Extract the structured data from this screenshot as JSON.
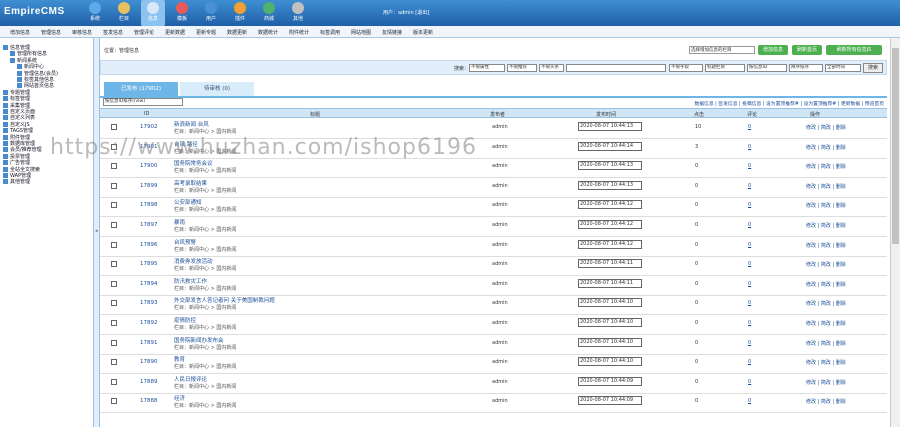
{
  "app": {
    "logo": "EmpireCMS"
  },
  "top_nav": [
    {
      "label": "系统",
      "icon": "globe-icon",
      "color": "#5fa8e8"
    },
    {
      "label": "栏目",
      "icon": "folder-icon",
      "color": "#e8c060"
    },
    {
      "label": "信息",
      "icon": "document-icon",
      "color": "#d8e8f8"
    },
    {
      "label": "模板",
      "icon": "template-icon",
      "color": "#e85a5a"
    },
    {
      "label": "用户",
      "icon": "user-icon",
      "color": "#4a90d9"
    },
    {
      "label": "插件",
      "icon": "plugin-icon",
      "color": "#f0a030"
    },
    {
      "label": "商城",
      "icon": "shop-icon",
      "color": "#50b070"
    },
    {
      "label": "其他",
      "icon": "gear-icon",
      "color": "#c0c0c0"
    }
  ],
  "user_info": "用户：admin [退出]",
  "menu_bar": [
    "增加信息",
    "管理信息",
    "审核信息",
    "签发信息",
    "管理评论",
    "更新数据",
    "更新专题",
    "数据更新",
    "数据统计",
    "附件统计",
    "标签调用",
    "网站地图",
    "友情链接",
    "版本更新"
  ],
  "sidebar": [
    {
      "label": "信息管理",
      "indent": 0
    },
    {
      "label": "管理所有信息",
      "indent": 1
    },
    {
      "label": "新闻系统",
      "indent": 1
    },
    {
      "label": "新闻中心",
      "indent": 2
    },
    {
      "label": "管理信息(会员)",
      "indent": 2
    },
    {
      "label": "标签其他信息",
      "indent": 2
    },
    {
      "label": "网站首页信息",
      "indent": 2
    },
    {
      "label": "专题管理",
      "indent": 0
    },
    {
      "label": "标签管理",
      "indent": 0
    },
    {
      "label": "采集管理",
      "indent": 0
    },
    {
      "label": "自定义页面",
      "indent": 0
    },
    {
      "label": "自定义列表",
      "indent": 0
    },
    {
      "label": "自定义JS",
      "indent": 0
    },
    {
      "label": "TAGS管理",
      "indent": 0
    },
    {
      "label": "附件管理",
      "indent": 0
    },
    {
      "label": "数据库管理",
      "indent": 0
    },
    {
      "label": "会员/推荐管理",
      "indent": 0
    },
    {
      "label": "投票管理",
      "indent": 0
    },
    {
      "label": "广告管理",
      "indent": 0
    },
    {
      "label": "全站全文搜索",
      "indent": 0
    },
    {
      "label": "WAP管理",
      "indent": 0
    },
    {
      "label": "其他管理",
      "indent": 0
    }
  ],
  "breadcrumb": "位置：管理信息",
  "channel_select": "选择增加信息的栏目",
  "buttons": {
    "add": "增加信息",
    "refresh": "刷新首页",
    "refresh_all": "刷新所有信息JS"
  },
  "search": {
    "label": "搜索：",
    "selects": [
      "不限属性",
      "不限推荐",
      "不限头条",
      "",
      "不限字段",
      "标题栏目",
      "按信息ID",
      "降序排序",
      "全部时间"
    ],
    "button": "搜索"
  },
  "tabs": {
    "published": "已发布 (17902)",
    "pending": "待审核 (0)"
  },
  "view_select": "按信息ID排序(new)",
  "links": "数据信息 | 签发信息 | 投稿信息 | 设为置顶推荐# | 设为置顶推荐# | 更新数据 | 预览首页",
  "table": {
    "headers": {
      "id": "ID",
      "title": "标题",
      "publisher": "发布者",
      "date": "发布时间",
      "clicks": "点击",
      "comments": "评论",
      "ops": "操作"
    },
    "rows": [
      {
        "id": "17902",
        "title": "新浪新闻 台风",
        "column": "栏目：新闻中心 > 国内新闻",
        "publisher": "admin",
        "date": "2020-08-07 10:44:13",
        "clicks": "10",
        "comments": "0"
      },
      {
        "id": "17901",
        "title": "台风 路径",
        "column": "栏目：新闻中心 > 国内新闻",
        "publisher": "admin",
        "date": "2020-08-07 10:44:14",
        "clicks": "3",
        "comments": "0"
      },
      {
        "id": "17900",
        "title": "国务院常务会议",
        "column": "栏目：新闻中心 > 国内新闻",
        "publisher": "admin",
        "date": "2020-08-07 10:44:13",
        "clicks": "0",
        "comments": "0"
      },
      {
        "id": "17899",
        "title": "高考录取结果",
        "column": "栏目：新闻中心 > 国内新闻",
        "publisher": "admin",
        "date": "2020-08-07 10:44:13",
        "clicks": "0",
        "comments": "0"
      },
      {
        "id": "17898",
        "title": "公安部通知",
        "column": "栏目：新闻中心 > 国内新闻",
        "publisher": "admin",
        "date": "2020-08-07 10:44:12",
        "clicks": "0",
        "comments": "0"
      },
      {
        "id": "17897",
        "title": "暴雨",
        "column": "栏目：新闻中心 > 国内新闻",
        "publisher": "admin",
        "date": "2020-08-07 10:44:12",
        "clicks": "0",
        "comments": "0"
      },
      {
        "id": "17896",
        "title": "台风预警",
        "column": "栏目：新闻中心 > 国内新闻",
        "publisher": "admin",
        "date": "2020-08-07 10:44:12",
        "clicks": "0",
        "comments": "0"
      },
      {
        "id": "17895",
        "title": "消费券发放活动",
        "column": "栏目：新闻中心 > 国内新闻",
        "publisher": "admin",
        "date": "2020-08-07 10:44:11",
        "clicks": "0",
        "comments": "0"
      },
      {
        "id": "17894",
        "title": "防汛救灾工作",
        "column": "栏目：新闻中心 > 国内新闻",
        "publisher": "admin",
        "date": "2020-08-07 10:44:11",
        "clicks": "0",
        "comments": "0"
      },
      {
        "id": "17893",
        "title": "外交部发言人答记者问 关于美国制裁问题",
        "column": "栏目：新闻中心 > 国内新闻",
        "publisher": "admin",
        "date": "2020-08-07 10:44:10",
        "clicks": "0",
        "comments": "0"
      },
      {
        "id": "17892",
        "title": "疫情防控",
        "column": "栏目：新闻中心 > 国内新闻",
        "publisher": "admin",
        "date": "2020-08-07 10:44:10",
        "clicks": "0",
        "comments": "0"
      },
      {
        "id": "17891",
        "title": "国务院新闻办发布会",
        "column": "栏目：新闻中心 > 国内新闻",
        "publisher": "admin",
        "date": "2020-08-07 10:44:10",
        "clicks": "0",
        "comments": "0"
      },
      {
        "id": "17890",
        "title": "教育",
        "column": "栏目：新闻中心 > 国内新闻",
        "publisher": "admin",
        "date": "2020-08-07 10:44:10",
        "clicks": "0",
        "comments": "0"
      },
      {
        "id": "17889",
        "title": "人民日报评论",
        "column": "栏目：新闻中心 > 国内新闻",
        "publisher": "admin",
        "date": "2020-08-07 10:44:09",
        "clicks": "0",
        "comments": "0"
      },
      {
        "id": "17888",
        "title": "经济",
        "column": "栏目：新闻中心 > 国内新闻",
        "publisher": "admin",
        "date": "2020-08-07 10:44:09",
        "clicks": "0",
        "comments": "0"
      }
    ],
    "ops": "修改 | 简改 | 删除"
  },
  "watermark": "https://www.huzhan.com/ishop6196"
}
